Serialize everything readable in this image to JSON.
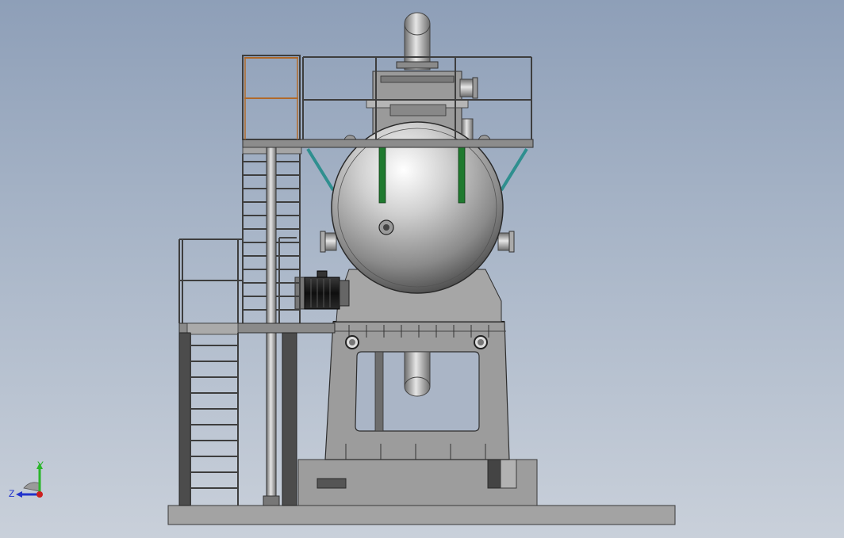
{
  "triad": {
    "y_label": "Y",
    "z_label": "Z",
    "y_color": "#2bb52b",
    "z_color": "#2233cc",
    "origin_color": "#cc2020"
  },
  "colors": {
    "steel": "#8f8f8f",
    "handrail": "#5a5a5a",
    "ladder_accent": "#b06a2a",
    "brace": "#2f8f8f",
    "stiffener": "#1f7a2f",
    "motor": "#1a1a1a"
  }
}
